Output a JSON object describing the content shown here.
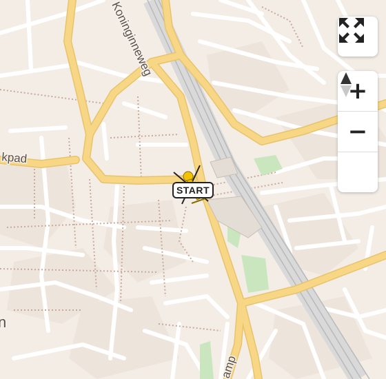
{
  "map": {
    "streets": {
      "koninginneweg": "Koninginneweg",
      "left_partial": "kpad",
      "bottom_partial": "amp",
      "edge_partial": "n"
    },
    "colors": {
      "land": "#f3ede6",
      "block": "#ede5dc",
      "minor_road": "#ffffff",
      "major_road": "#f5d27a",
      "rail": "#b9b9b9",
      "park": "#c9e6bf",
      "path": "#c9a99a"
    }
  },
  "marker": {
    "label": "START",
    "color": "#f2c200",
    "icon": "helicopter-icon"
  },
  "controls": {
    "fullscreen_icon": "fullscreen-icon",
    "zoom_in": "+",
    "zoom_out": "−",
    "compass_icon": "compass-icon"
  }
}
